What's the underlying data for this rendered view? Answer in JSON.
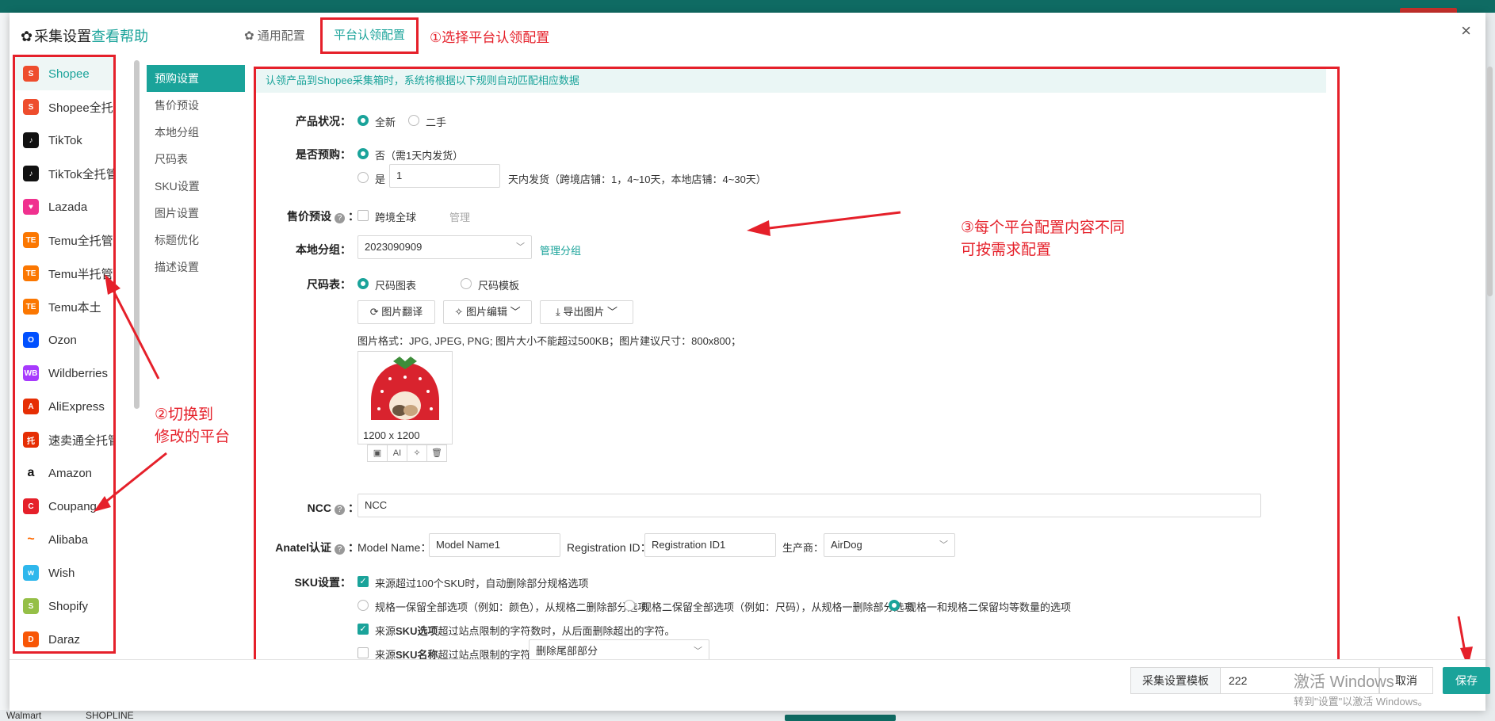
{
  "background": {
    "bottom_left": "Walmart",
    "bottom_mid": "SHOPLINE"
  },
  "dialog": {
    "title": "采集设置",
    "help_link": "查看帮助",
    "tabs": {
      "general": "通用配置",
      "platform": "平台认领配置"
    },
    "close": "×"
  },
  "annotations": {
    "step1": "①选择平台认领配置",
    "step2_line1": "②切换到",
    "step2_line2": "修改的平台",
    "step3_line1": "③每个平台配置内容不同",
    "step3_line2": "可按需求配置"
  },
  "platforms": [
    {
      "label": "Shopee",
      "icon": "shopee-icon",
      "color": "#ee4d2d",
      "glyph": "S",
      "active": true
    },
    {
      "label": "Shopee全托管",
      "icon": "shopee-icon",
      "color": "#ee4d2d",
      "glyph": "S"
    },
    {
      "label": "TikTok",
      "icon": "tiktok-icon",
      "color": "#111111",
      "glyph": "♪"
    },
    {
      "label": "TikTok全托管",
      "icon": "tiktok-icon",
      "color": "#111111",
      "glyph": "♪"
    },
    {
      "label": "Lazada",
      "icon": "lazada-icon",
      "color": "#f0318f",
      "glyph": "♥"
    },
    {
      "label": "Temu全托管",
      "icon": "temu-icon",
      "color": "#fb7701",
      "glyph": "TE"
    },
    {
      "label": "Temu半托管",
      "icon": "temu-icon",
      "color": "#fb7701",
      "glyph": "TE"
    },
    {
      "label": "Temu本土",
      "icon": "temu-icon",
      "color": "#fb7701",
      "glyph": "TE"
    },
    {
      "label": "Ozon",
      "icon": "ozon-icon",
      "color": "#0050ff",
      "glyph": "O"
    },
    {
      "label": "Wildberries",
      "icon": "wildberries-icon",
      "color": "#a73afd",
      "glyph": "WB"
    },
    {
      "label": "AliExpress",
      "icon": "aliexpress-icon",
      "color": "#e62e04",
      "glyph": "A"
    },
    {
      "label": "速卖通全托管",
      "icon": "aliexpress-managed-icon",
      "color": "#e62e04",
      "glyph": "托"
    },
    {
      "label": "Amazon",
      "icon": "amazon-icon",
      "color": "#ffffff",
      "glyph": "a"
    },
    {
      "label": "Coupang",
      "icon": "coupang-icon",
      "color": "#e5202a",
      "glyph": "C"
    },
    {
      "label": "Alibaba",
      "icon": "alibaba-icon",
      "color": "#ffffff",
      "glyph": "~"
    },
    {
      "label": "Wish",
      "icon": "wish-icon",
      "color": "#2fb7ec",
      "glyph": "w"
    },
    {
      "label": "Shopify",
      "icon": "shopify-icon",
      "color": "#95bf47",
      "glyph": "S"
    },
    {
      "label": "Daraz",
      "icon": "daraz-icon",
      "color": "#f85606",
      "glyph": "D"
    }
  ],
  "subnav": [
    {
      "label": "预购设置",
      "active": true
    },
    {
      "label": "售价预设"
    },
    {
      "label": "本地分组"
    },
    {
      "label": "尺码表"
    },
    {
      "label": "SKU设置"
    },
    {
      "label": "图片设置"
    },
    {
      "label": "标题优化"
    },
    {
      "label": "描述设置"
    }
  ],
  "form": {
    "info": "认领产品到Shopee采集箱时，系统将根据以下规则自动匹配相应数据",
    "condition": {
      "label": "产品状况：",
      "new": "全新",
      "used": "二手"
    },
    "preorder": {
      "label": "是否预购：",
      "no": "否（需1天内发货）",
      "yes": "是",
      "days_value": "1",
      "days_hint": "天内发货（跨境店铺：1，4~10天，本地店铺：4~30天）"
    },
    "price_preset": {
      "label": "售价预设",
      "option": "跨境全球",
      "manage": "管理"
    },
    "local_group": {
      "label": "本地分组：",
      "value": "2023090909",
      "manage": "管理分组"
    },
    "size_chart": {
      "label": "尺码表：",
      "opt_image": "尺码图表",
      "opt_template": "尺码模板",
      "btn_translate": "图片翻译",
      "btn_edit": "图片编辑",
      "btn_export": "导出图片",
      "hint": "图片格式：JPG, JPEG, PNG; 图片大小不能超过500KB；图片建议尺寸：800x800；",
      "image_size": "1200 x 1200",
      "tool_ai": "AI"
    },
    "ncc": {
      "label": "NCC",
      "value": "NCC"
    },
    "anatel": {
      "label": "Anatel认证",
      "model_label": "Model Name：",
      "model_value": "Model Name1",
      "reg_label": "Registration ID：",
      "reg_value": "Registration ID1",
      "maker_label": "生产商：",
      "maker_value": "AirDog"
    },
    "sku": {
      "label": "SKU设置：",
      "opt1": "来源超过100个SKU时，自动删除部分规格选项",
      "r1": "规格一保留全部选项（例如：颜色），从规格二删除部分选项",
      "r2": "规格二保留全部选项（例如：尺码），从规格一删除部分选项",
      "r3": "规格一和规格二保留均等数量的选项",
      "opt2_pre": "来源",
      "opt2_bold": "SKU选项",
      "opt2_post": "超过站点限制的字符数时，从后面删除超出的字符。",
      "opt3_pre": "来源",
      "opt3_bold": "SKU名称",
      "opt3_post": "超过站点限制的字符数时，",
      "opt3_select": "删除尾部部分"
    }
  },
  "footer": {
    "template_label": "采集设置模板",
    "template_value": "222",
    "cancel": "取消",
    "save": "保存",
    "watermark1": "激活 Windows",
    "watermark2": "转到\"设置\"以激活 Windows。"
  },
  "colors": {
    "accent": "#1aa39a",
    "annotation": "#e5202a"
  }
}
